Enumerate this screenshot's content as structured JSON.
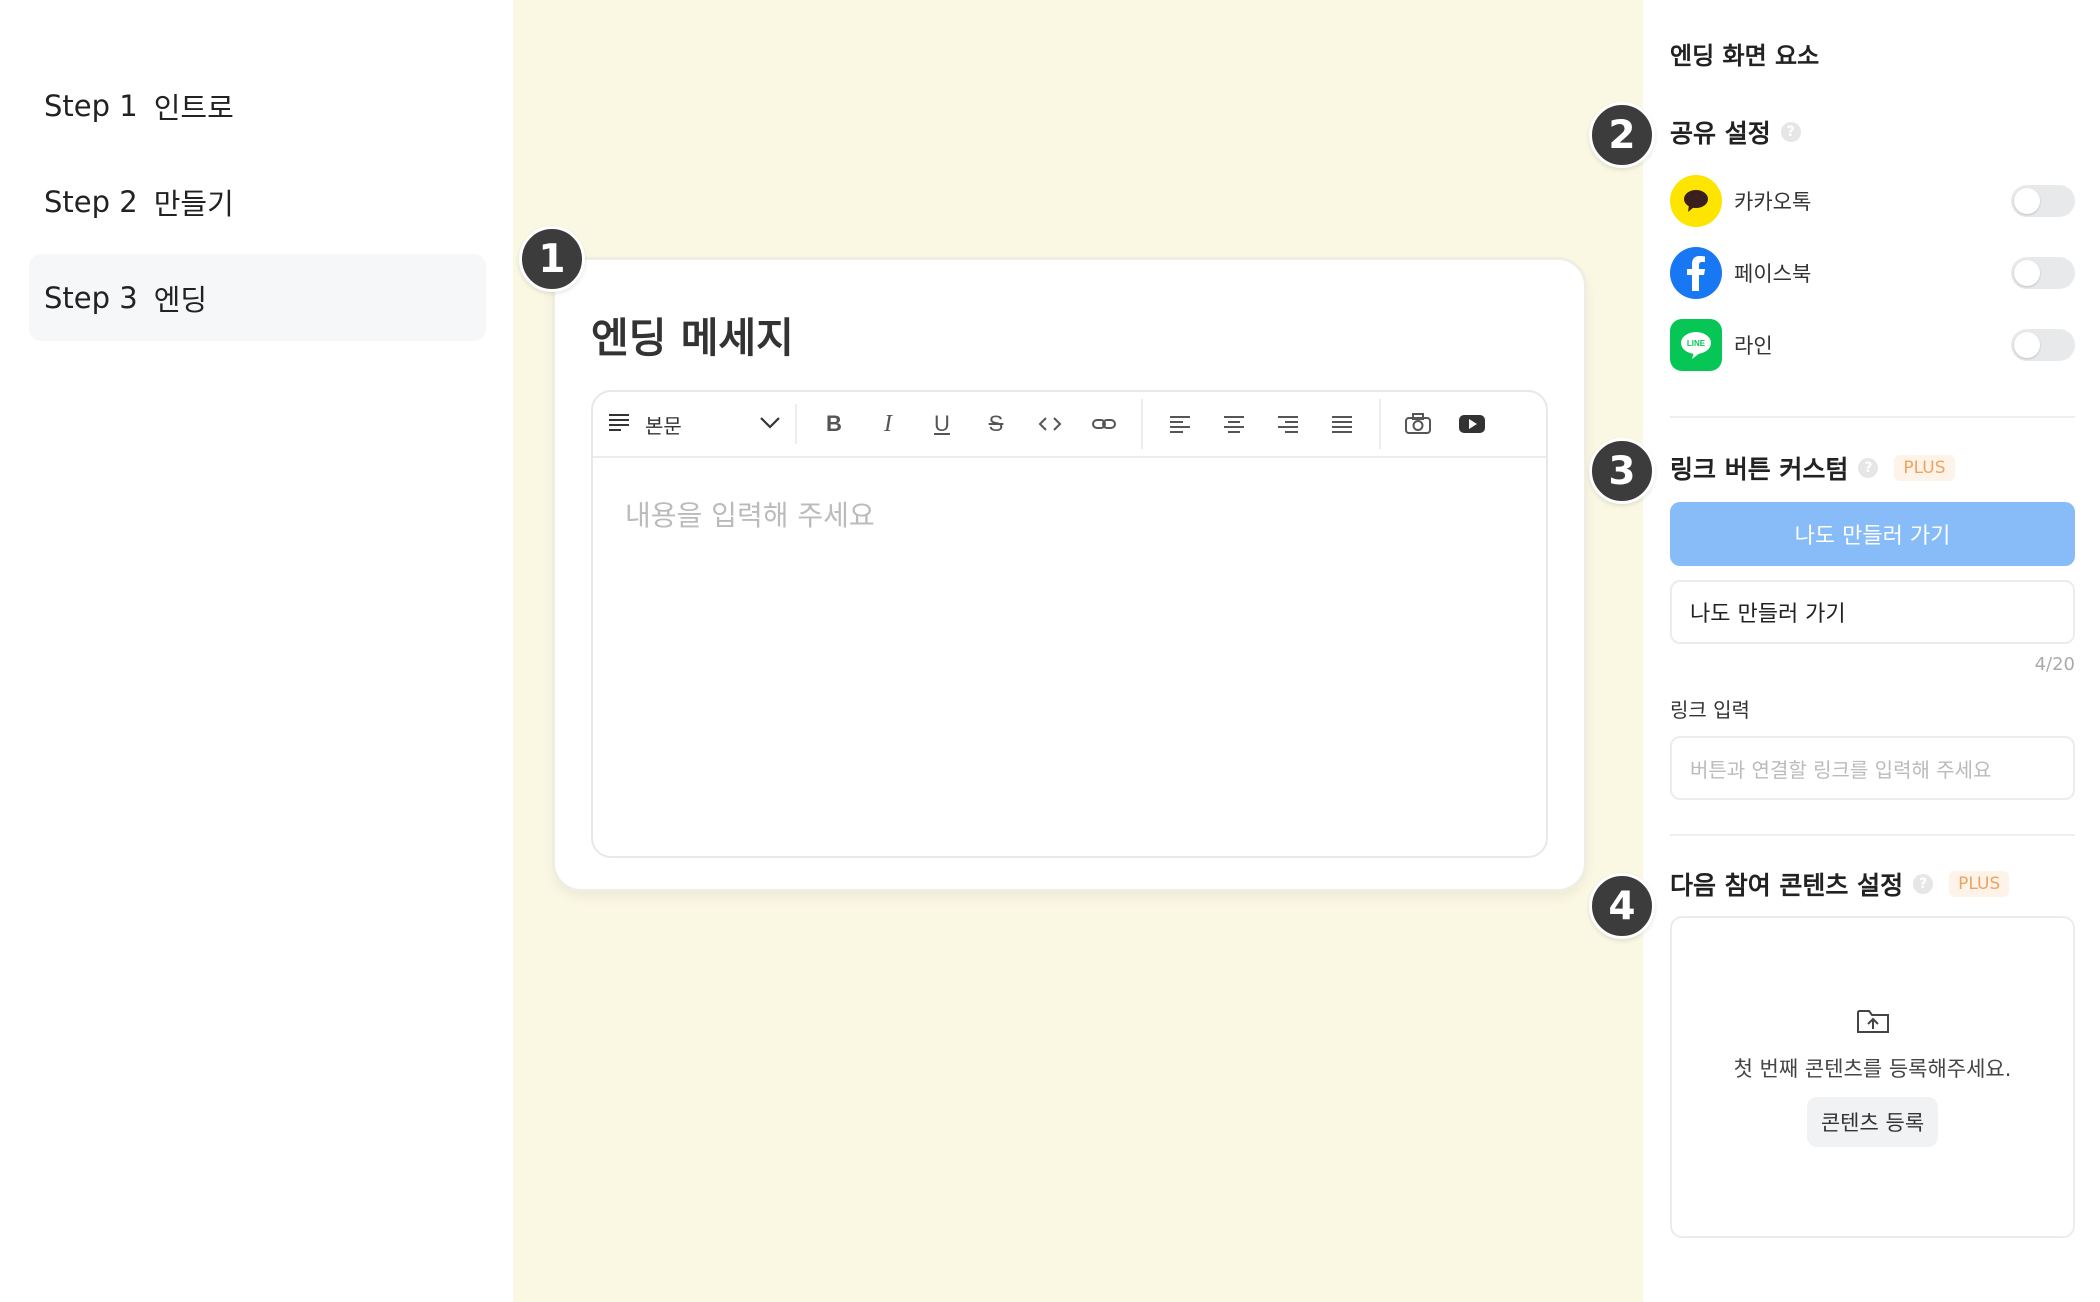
{
  "steps": [
    {
      "num": "Step 1",
      "label": "인트로",
      "active": false
    },
    {
      "num": "Step 2",
      "label": "만들기",
      "active": false
    },
    {
      "num": "Step 3",
      "label": "엔딩",
      "active": true
    }
  ],
  "badges": [
    "1",
    "2",
    "3",
    "4"
  ],
  "card": {
    "title": "엔딩 메세지",
    "format_select": "본문",
    "placeholder": "내용을 입력해 주세요",
    "toolbar_icons": [
      "bold-icon",
      "italic-icon",
      "underline-icon",
      "strikethrough-icon",
      "code-icon",
      "link-icon",
      "align-left-icon",
      "align-center-icon",
      "align-right-icon",
      "align-justify-icon",
      "camera-icon",
      "youtube-icon"
    ]
  },
  "panel": {
    "title": "엔딩 화면 요소",
    "share": {
      "title": "공유 설정",
      "items": [
        {
          "name": "카카오톡",
          "icon": "kakaotalk-icon",
          "color": "#FEE500",
          "enabled": false
        },
        {
          "name": "페이스북",
          "icon": "facebook-icon",
          "color": "#1877F2",
          "enabled": false
        },
        {
          "name": "라인",
          "icon": "line-icon",
          "color": "#06C755",
          "enabled": false
        }
      ]
    },
    "link_button": {
      "title": "링크 버튼 커스텀",
      "badge": "PLUS",
      "preview_label": "나도 만들러 가기",
      "input_value": "나도 만들러 가기",
      "counter": "4/20",
      "link_label": "링크 입력",
      "link_placeholder": "버튼과 연결할 링크를 입력해 주세요"
    },
    "next_content": {
      "title": "다음 참여 콘텐츠 설정",
      "badge": "PLUS",
      "empty_text": "첫 번째 콘텐츠를 등록해주세요.",
      "register_button": "콘텐츠 등록"
    }
  },
  "colors": {
    "canvas_bg": "#faf7e3",
    "accent_button": "#87bcf8",
    "badge_bg": "#3c3c3c",
    "plus_text": "#f0a35e"
  }
}
